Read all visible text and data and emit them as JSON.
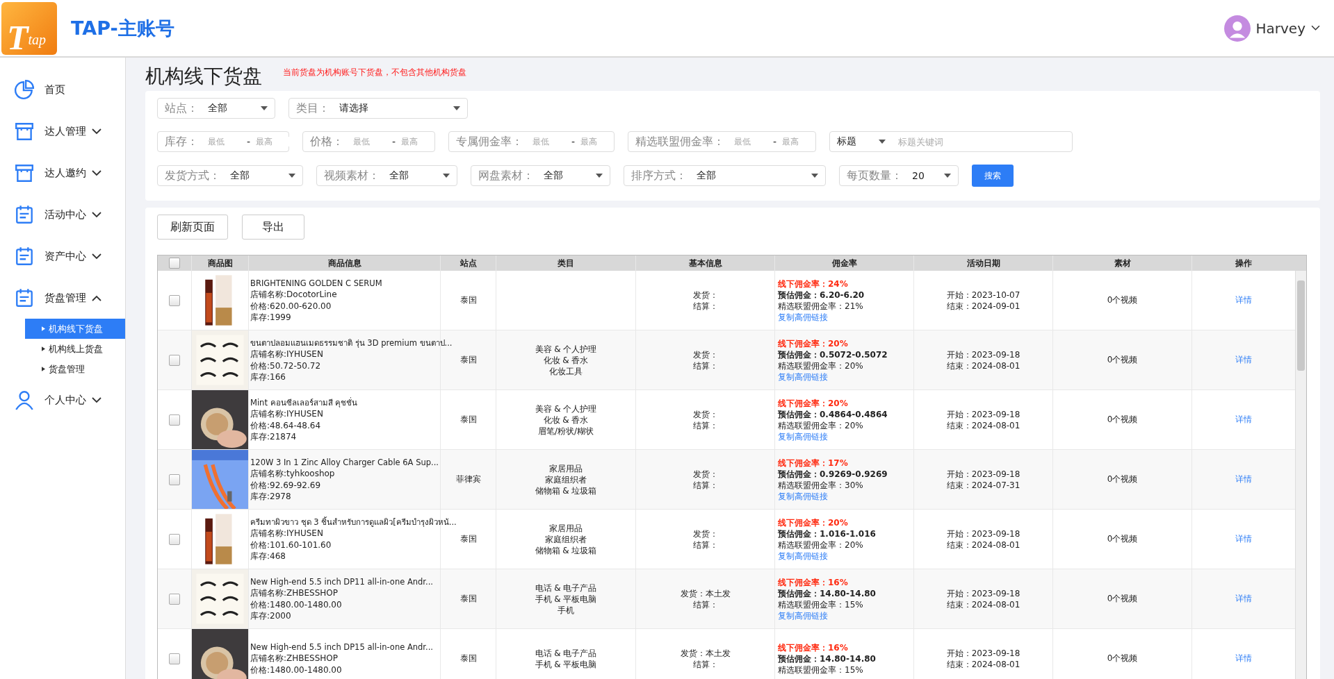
{
  "header": {
    "logo": {
      "letter": "T",
      "word": "tap"
    },
    "title": "TAP-主账号",
    "user": "Harvey"
  },
  "sidebar": {
    "items": [
      {
        "label": "首页",
        "kind": "link"
      },
      {
        "label": "达人管理",
        "kind": "menu",
        "expanded": false
      },
      {
        "label": "达人邀约",
        "kind": "menu",
        "expanded": false
      },
      {
        "label": "活动中心",
        "kind": "menu",
        "expanded": false
      },
      {
        "label": "资产中心",
        "kind": "menu",
        "expanded": false
      },
      {
        "label": "货盘管理",
        "kind": "menu",
        "expanded": true,
        "children": [
          {
            "label": "机构线下货盘",
            "selected": true
          },
          {
            "label": "机构线上货盘",
            "selected": false
          },
          {
            "label": "货盘管理",
            "selected": false
          }
        ]
      },
      {
        "label": "个人中心",
        "kind": "menu",
        "expanded": false
      }
    ]
  },
  "page": {
    "title": "机构线下货盘",
    "notice": "当前货盘为机构账号下货盘，不包含其他机构货盘"
  },
  "filters": {
    "rows": [
      [
        {
          "kind": "select",
          "label": "站点：",
          "value": "全部"
        },
        {
          "kind": "select",
          "label": "类目：",
          "value": "请选择"
        }
      ],
      [
        {
          "kind": "range",
          "label": "库存：",
          "inputs": [
            {
              "placeholder": "最低"
            },
            {
              "placeholder": "最高"
            }
          ],
          "dash": "-"
        },
        {
          "kind": "range",
          "label": "价格：",
          "inputs": [
            {
              "placeholder": "最低"
            },
            {
              "placeholder": "最高"
            }
          ],
          "dash": "-"
        },
        {
          "kind": "range",
          "label": "专属佣金率：",
          "inputs": [
            {
              "placeholder": "最低"
            },
            {
              "placeholder": "最高"
            }
          ],
          "dash": "-"
        },
        {
          "kind": "range",
          "label": "精选联盟佣金率：",
          "inputs": [
            {
              "placeholder": "最低"
            },
            {
              "placeholder": "最高"
            }
          ],
          "dash": "-"
        },
        {
          "kind": "keyword",
          "value": "标题",
          "placeholder": "标题关键词"
        }
      ],
      [
        {
          "kind": "select",
          "label": "发货方式：",
          "value": "全部"
        },
        {
          "kind": "select",
          "label": "视频素材：",
          "value": "全部"
        },
        {
          "kind": "select",
          "label": "网盘素材：",
          "value": "全部"
        },
        {
          "kind": "select",
          "label": "排序方式：",
          "value": "全部"
        },
        {
          "kind": "select",
          "label": "每页数量：",
          "value": "20"
        },
        {
          "kind": "button",
          "label": "搜索"
        }
      ]
    ]
  },
  "actions": [
    "刷新页面",
    "导出"
  ],
  "table": {
    "select_all": false,
    "columns": [
      "商品图",
      "商品信息",
      "站点",
      "类目",
      "基本信息",
      "佣金率",
      "活动日期",
      "素材",
      "操作"
    ],
    "rows": [
      {
        "checked": false,
        "title": "BRIGHTENING GOLDEN C SERUM",
        "shop": "店铺名称:DocotorLine",
        "price": "价格:620.00-620.00",
        "stock": "库存:1999",
        "site": "泰国",
        "category": [],
        "ship": "发货：",
        "settle": "结算：",
        "offline": "线下佣金率：24%",
        "estimate": "预估佣金：6.20-6.20",
        "alliance": "精选联盟佣金率：21%",
        "link": "复制高佣链接",
        "start": "开始：2023-10-07",
        "end": "结束：2024-09-01",
        "material": "0个视频",
        "op": "详情"
      },
      {
        "checked": false,
        "title": "ขนตาปลอมแฮนเมดธรรมชาติ รุ่น 3D premium ขนตาป...",
        "shop": "店铺名称:IYHUSEN",
        "price": "价格:50.72-50.72",
        "stock": "库存:166",
        "site": "泰国",
        "category": [
          "美容 & 个人护理",
          "化妆 & 香水",
          "化妆工具"
        ],
        "ship": "发货：",
        "settle": "结算：",
        "offline": "线下佣金率：20%",
        "estimate": "预估佣金：0.5072-0.5072",
        "alliance": "精选联盟佣金率：20%",
        "link": "复制高佣链接",
        "start": "开始：2023-09-18",
        "end": "结束：2024-08-01",
        "material": "0个视频",
        "op": "详情"
      },
      {
        "checked": false,
        "title": "Mint คอนซีลเลอร์สามสี คุชชั่น",
        "shop": "店铺名称:IYHUSEN",
        "price": "价格:48.64-48.64",
        "stock": "库存:21874",
        "site": "泰国",
        "category": [
          "美容 & 个人护理",
          "化妆 & 香水",
          "眉笔/粉状/糊状"
        ],
        "ship": "发货：",
        "settle": "结算：",
        "offline": "线下佣金率：20%",
        "estimate": "预估佣金：0.4864-0.4864",
        "alliance": "精选联盟佣金率：20%",
        "link": "复制高佣链接",
        "start": "开始：2023-09-18",
        "end": "结束：2024-08-01",
        "material": "0个视频",
        "op": "详情"
      },
      {
        "checked": false,
        "title": "120W 3 In 1 Zinc Alloy Charger Cable 6A Sup...",
        "shop": "店铺名称:tyhkooshop",
        "price": "价格:92.69-92.69",
        "stock": "库存:2978",
        "site": "菲律宾",
        "category": [
          "家居用品",
          "家庭组织者",
          "储物箱 & 垃圾箱"
        ],
        "ship": "发货：",
        "settle": "结算：",
        "offline": "线下佣金率：17%",
        "estimate": "预估佣金：0.9269-0.9269",
        "alliance": "精选联盟佣金率：30%",
        "link": "复制高佣链接",
        "start": "开始：2023-09-18",
        "end": "结束：2024-07-31",
        "material": "0个视频",
        "op": "详情"
      },
      {
        "checked": false,
        "title": "ครีมทาผิวขาว ชุด 3 ชิ้นสำหรับการดูแลผิว[ครีมบำรุงผิวหน้...",
        "shop": "店铺名称:IYHUSEN",
        "price": "价格:101.60-101.60",
        "stock": "库存:468",
        "site": "泰国",
        "category": [
          "家居用品",
          "家庭组织者",
          "储物箱 & 垃圾箱"
        ],
        "ship": "发货：",
        "settle": "结算：",
        "offline": "线下佣金率：20%",
        "estimate": "预估佣金：1.016-1.016",
        "alliance": "精选联盟佣金率：20%",
        "link": "复制高佣链接",
        "start": "开始：2023-09-18",
        "end": "结束：2024-08-01",
        "material": "0个视频",
        "op": "详情"
      },
      {
        "checked": false,
        "title": "New High-end 5.5 inch DP11 all-in-one Andr...",
        "shop": "店铺名称:ZHBESSHOP",
        "price": "价格:1480.00-1480.00",
        "stock": "库存:2000",
        "site": "泰国",
        "category": [
          "电话 & 电子产品",
          "手机 & 平板电脑",
          "手机"
        ],
        "ship": "发货：本土发",
        "settle": "结算：",
        "offline": "线下佣金率：16%",
        "estimate": "预估佣金：14.80-14.80",
        "alliance": "精选联盟佣金率：15%",
        "link": "复制高佣链接",
        "start": "开始：2023-09-18",
        "end": "结束：2024-08-01",
        "material": "0个视频",
        "op": "详情"
      },
      {
        "checked": false,
        "title": "New High-end 5.5 inch DP15 all-in-one Andr...",
        "shop": "店铺名称:ZHBESSHOP",
        "price": "价格:1480.00-1480.00",
        "site": "泰国",
        "category": [
          "电话 & 电子产品",
          "手机 & 平板电脑"
        ],
        "ship": "发货：本土发",
        "settle": "结算：",
        "offline": "线下佣金率：16%",
        "estimate": "预估佣金：14.80-14.80",
        "alliance": "精选联盟佣金率：15%",
        "start": "开始：2023-09-18",
        "end": "结束：2024-08-01",
        "material": "0个视频",
        "op": "详情"
      }
    ]
  }
}
